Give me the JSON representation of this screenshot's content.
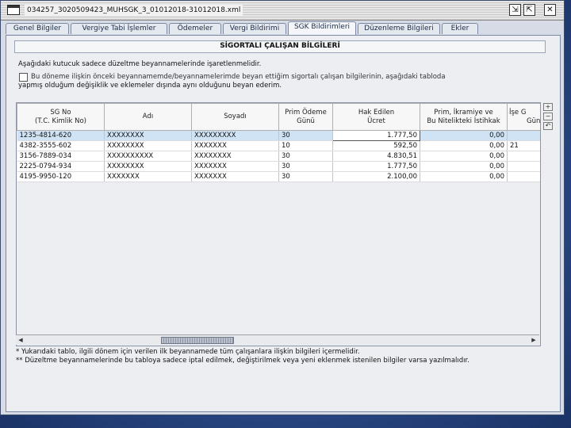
{
  "window": {
    "title": "034257_3020509423_MUHSGK_3_01012018-31012018.xml"
  },
  "tabs": [
    {
      "label": "Genel Bilgiler"
    },
    {
      "label": "Vergiye Tabi İşlemler"
    },
    {
      "label": "Ödemeler"
    },
    {
      "label": "Vergi Bildirimi"
    },
    {
      "label": "SGK Bildirimleri",
      "active": true
    },
    {
      "label": "Düzenleme Bilgileri"
    },
    {
      "label": "Ekler"
    }
  ],
  "section": {
    "title": "SİGORTALI ÇALIŞAN BİLGİLERİ",
    "instruction": "Aşağıdaki kutucuk sadece düzeltme beyannamelerinde işaretlenmelidir.",
    "checkbox_line1": "Bu döneme ilişkin önceki beyannamemde/beyannamelerimde beyan ettiğim sigortalı çalışan bilgilerinin, aşağıdaki tabloda",
    "checkbox_line2": "yapmış olduğum değişiklik ve eklemeler dışında aynı olduğunu beyan ederim."
  },
  "table": {
    "headers": [
      {
        "line1": "SG No",
        "line2": "(T.C. Kimlik No)"
      },
      {
        "line1": "Adı",
        "line2": ""
      },
      {
        "line1": "Soyadı",
        "line2": ""
      },
      {
        "line1": "Prim Ödeme",
        "line2": "Günü"
      },
      {
        "line1": "Hak Edilen",
        "line2": "Ücret"
      },
      {
        "line1": "Prim, İkramiye ve",
        "line2": "Bu Nitelikteki İstihkak"
      },
      {
        "line1": "İşe G",
        "line2": "Gün"
      }
    ],
    "rows": [
      {
        "sgno": "1235-4814-620",
        "adi": "XXXXXXXX",
        "soyadi": "XXXXXXXXX",
        "gun": "30",
        "ucret": "1.777,50",
        "prim": "0,00",
        "ise": ""
      },
      {
        "sgno": "4382-3555-602",
        "adi": "XXXXXXXX",
        "soyadi": "XXXXXXX",
        "gun": "10",
        "ucret": "592,50",
        "prim": "0,00",
        "ise": "21"
      },
      {
        "sgno": "3156-7889-034",
        "adi": "XXXXXXXXXX",
        "soyadi": "XXXXXXXX",
        "gun": "30",
        "ucret": "4.830,51",
        "prim": "0,00",
        "ise": ""
      },
      {
        "sgno": "2225-0794-934",
        "adi": "XXXXXXXX",
        "soyadi": "XXXXXXX",
        "gun": "30",
        "ucret": "1.777,50",
        "prim": "0,00",
        "ise": ""
      },
      {
        "sgno": "4195-9950-120",
        "adi": "XXXXXXX",
        "soyadi": "XXXXXXX",
        "gun": "30",
        "ucret": "2.100,00",
        "prim": "0,00",
        "ise": ""
      }
    ]
  },
  "side_buttons": [
    {
      "icon": "add-row-icon",
      "glyph": "+"
    },
    {
      "icon": "remove-row-icon",
      "glyph": "−"
    },
    {
      "icon": "undo-row-icon",
      "glyph": "↶"
    }
  ],
  "notes": [
    "* Yukarıdaki tablo, ilgili dönem için verilen ilk beyannamede tüm çalışanlara ilişkin bilgileri içermelidir.",
    "** Düzeltme beyannamelerinde bu tabloya sadece iptal edilmek, değiştirilmek veya yeni eklenmek istenilen bilgiler varsa yazılmalıdır."
  ],
  "window_buttons": {
    "minimize": "⇲",
    "maximize": "⇱",
    "close": "✕"
  }
}
